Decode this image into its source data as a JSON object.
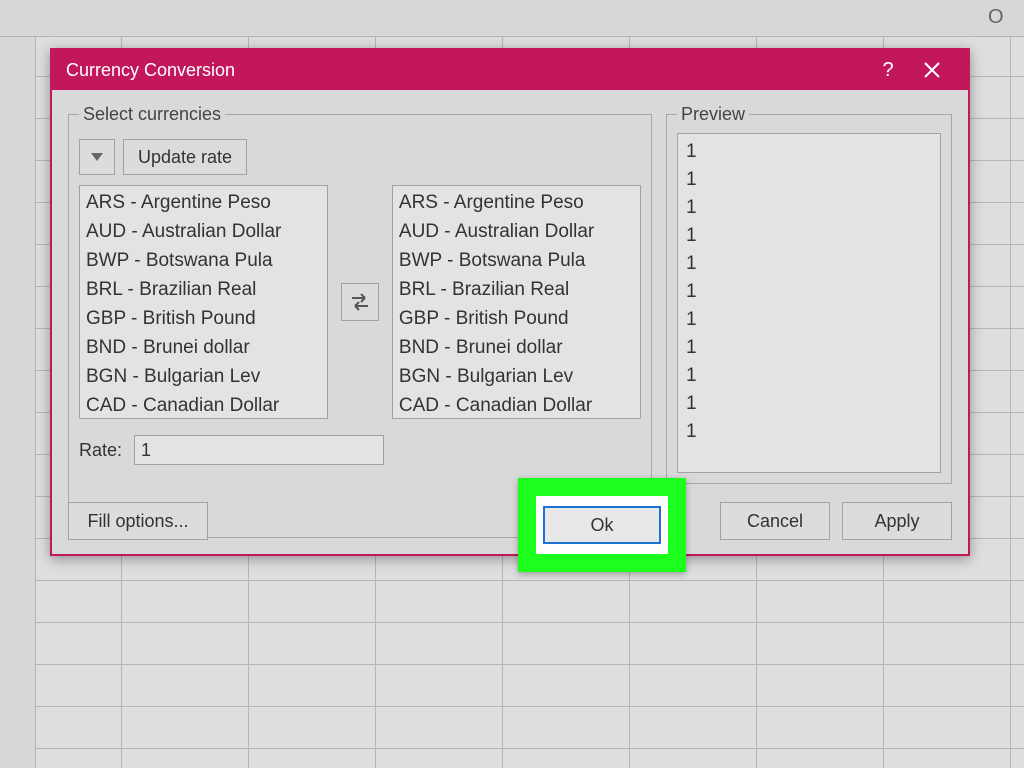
{
  "spreadsheet": {
    "visible_column_letter": "O"
  },
  "dialog": {
    "title": "Currency Conversion",
    "help_icon": "?",
    "select_group_label": "Select currencies",
    "update_button": "Update rate",
    "swap_icon": "swap-horizontal",
    "currencies": [
      "ARS - Argentine Peso",
      "AUD - Australian Dollar",
      "BWP - Botswana Pula",
      "BRL - Brazilian Real",
      "GBP - British Pound",
      "BND - Brunei dollar",
      "BGN - Bulgarian Lev",
      "CAD - Canadian Dollar"
    ],
    "rate_label": "Rate:",
    "rate_value": "1",
    "preview_label": "Preview",
    "preview_values": [
      "1",
      "1",
      "1",
      "1",
      "1",
      "1",
      "1",
      "1",
      "1",
      "1",
      "1"
    ],
    "buttons": {
      "fill_options": "Fill options...",
      "ok": "Ok",
      "cancel": "Cancel",
      "apply": "Apply"
    }
  },
  "colors": {
    "accent": "#c2185b",
    "highlight": "#1cff1c",
    "ok_border": "#1e73d2"
  }
}
